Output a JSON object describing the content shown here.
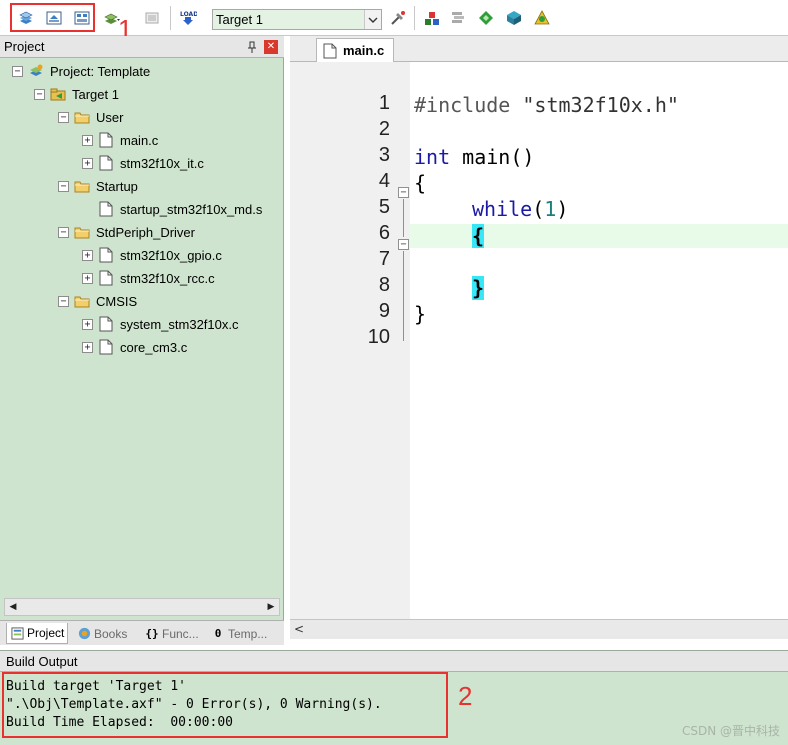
{
  "toolbar": {
    "target_selected": "Target 1",
    "annotation_1": "1",
    "icons": [
      "translate-icon",
      "build-icon",
      "rebuild-icon",
      "batch-build-icon",
      "stop-build-icon",
      "download-icon",
      "target-options-icon",
      "file-extensions-icon",
      "manage-components-icon",
      "select-packs-icon",
      "pack-installer-icon",
      "rte-icon"
    ]
  },
  "project": {
    "header": "Project",
    "tree": [
      {
        "label": "Project: Template",
        "level": 0,
        "icon": "project-icon",
        "expander": "-"
      },
      {
        "label": "Target 1",
        "level": 1,
        "icon": "target-icon",
        "expander": "-"
      },
      {
        "label": "User",
        "level": 2,
        "icon": "folder-icon",
        "expander": "-"
      },
      {
        "label": "main.c",
        "level": 3,
        "icon": "file-icon",
        "expander": "+"
      },
      {
        "label": "stm32f10x_it.c",
        "level": 3,
        "icon": "file-icon",
        "expander": "+"
      },
      {
        "label": "Startup",
        "level": 2,
        "icon": "folder-icon",
        "expander": "-"
      },
      {
        "label": "startup_stm32f10x_md.s",
        "level": 3,
        "icon": "file-icon",
        "expander": ""
      },
      {
        "label": "StdPeriph_Driver",
        "level": 2,
        "icon": "folder-icon",
        "expander": "-"
      },
      {
        "label": "stm32f10x_gpio.c",
        "level": 3,
        "icon": "file-icon",
        "expander": "+"
      },
      {
        "label": "stm32f10x_rcc.c",
        "level": 3,
        "icon": "file-icon",
        "expander": "+"
      },
      {
        "label": "CMSIS",
        "level": 2,
        "icon": "folder-icon",
        "expander": "-"
      },
      {
        "label": "system_stm32f10x.c",
        "level": 3,
        "icon": "file-icon",
        "expander": "+"
      },
      {
        "label": "core_cm3.c",
        "level": 3,
        "icon": "file-icon",
        "expander": "+"
      }
    ],
    "tabs": [
      {
        "label": "Project",
        "icon": "project-tab-icon",
        "active": true
      },
      {
        "label": "Books",
        "icon": "books-icon",
        "active": false
      },
      {
        "label": "Func...",
        "icon": "functions-icon",
        "active": false
      },
      {
        "label": "Temp...",
        "icon": "templates-icon",
        "active": false
      }
    ]
  },
  "editor": {
    "tab_label": "main.c",
    "line_numbers": [
      "1",
      "2",
      "3",
      "4",
      "5",
      "6",
      "7",
      "8",
      "9",
      "10"
    ],
    "code": {
      "l1_pp": "#include",
      "l1_str": "\"stm32f10x.h\"",
      "l3_type": "int",
      "l3_rest": " main()",
      "l4": "{",
      "l5_kw": "while",
      "l5_open": "(",
      "l5_num": "1",
      "l5_close": ")",
      "l6": "{",
      "l8": "}",
      "l9": "}"
    }
  },
  "build_output": {
    "header": "Build Output",
    "lines": [
      "Build target 'Target 1'",
      "\".\\Obj\\Template.axf\" - 0 Error(s), 0 Warning(s).",
      "Build Time Elapsed:  00:00:00"
    ],
    "annotation_2": "2",
    "watermark": "CSDN @晋中科技"
  },
  "colors": {
    "panel_green": "#cfe4cf",
    "annotation_red": "#e8322f",
    "brace_highlight": "#37e7f5",
    "keyword_blue": "#1a1aa6"
  }
}
